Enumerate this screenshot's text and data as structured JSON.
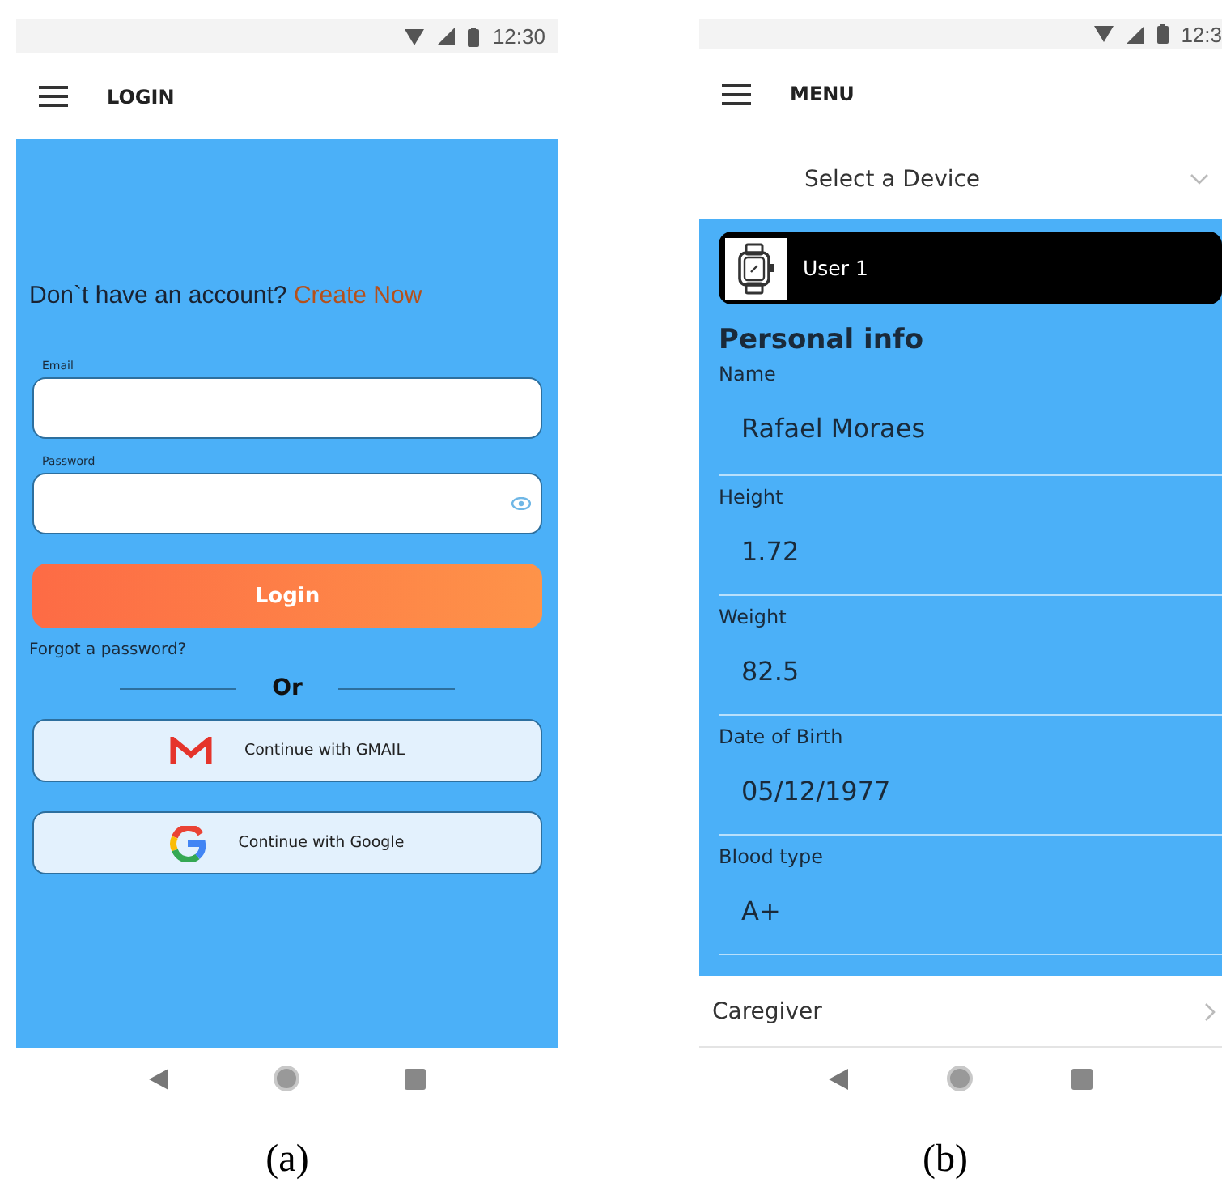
{
  "panels": [
    {
      "kind": "login",
      "caption": "(a)",
      "status_time": "12:30",
      "app_bar_title": "LOGIN",
      "signup_prompt": "Don`t have an account?",
      "signup_link": "Create Now",
      "fields": [
        {
          "label": "Email",
          "kind": "text"
        },
        {
          "label": "Password",
          "kind": "password"
        }
      ],
      "login_button": "Login",
      "forgot_link": "Forgot a password?",
      "divider_text": "Or",
      "social_buttons": [
        {
          "kind": "gmail",
          "label": "Continue with GMAIL"
        },
        {
          "kind": "google",
          "label": "Continue with Google"
        }
      ]
    },
    {
      "kind": "profile",
      "caption": "(b)",
      "status_time": "12:3",
      "app_bar_title": "MENU",
      "device_select": "Select a Device",
      "device_card": "User 1",
      "section_title": "Personal info",
      "fields": [
        {
          "label": "Name",
          "value": "Rafael Moraes"
        },
        {
          "label": "Height",
          "value": "1.72"
        },
        {
          "label": "Weight",
          "value": "82.5"
        },
        {
          "label": "Date of Birth",
          "value": "05/12/1977"
        },
        {
          "label": "Blood type",
          "value": "A+"
        }
      ],
      "caregiver": "Caregiver"
    }
  ]
}
